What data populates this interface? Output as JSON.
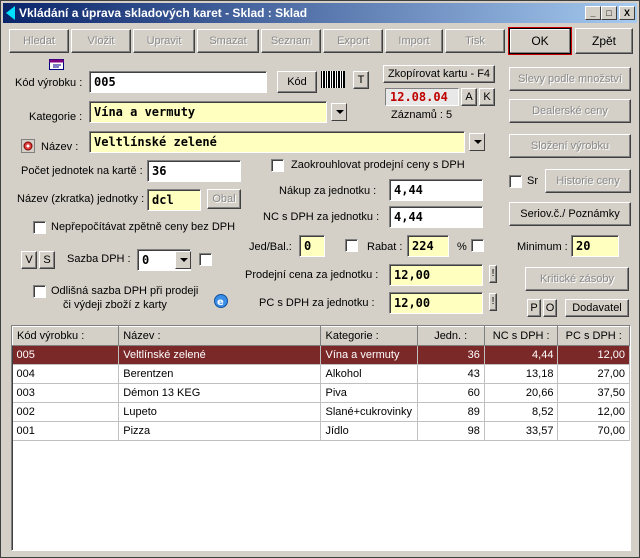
{
  "window": {
    "title": "Vkládání a úprava skladových karet  -  Sklad : Sklad",
    "min_label": "_",
    "max_label": "□",
    "close_label": "X"
  },
  "toolbar": {
    "buttons": [
      "Hledat",
      "Vložit",
      "Upravit",
      "Smazat",
      "Seznam",
      "Export",
      "Import",
      "Tisk"
    ],
    "ok_label": "OK",
    "back_label": "Zpět"
  },
  "form": {
    "code_label": "Kód výrobku :",
    "code_value": "005",
    "code_button": "Kód",
    "t_button": "T",
    "copy_button": "Zkopírovat kartu - F4",
    "date_value": "12.08.04",
    "a_button": "A",
    "k_button": "K",
    "records_label": "Záznamů : 5",
    "category_label": "Kategorie :",
    "category_value": "Vína a vermuty",
    "name_label": "Název :",
    "name_value": "Veltlínské zelené",
    "units_per_card_label": "Počet jednotek na kartě :",
    "units_per_card_value": "36",
    "unit_name_label": "Název (zkratka) jednotky :",
    "unit_name_value": "dcl",
    "obal_button": "Obal",
    "round_price_label": "Zaokrouhlovat prodejní ceny s DPH",
    "no_recalc_label": "Nepřepočítávat zpětně ceny bez DPH",
    "purchase_label": "Nákup za jednotku :",
    "purchase_value": "4,44",
    "nc_label": "NC s DPH za jednotku :",
    "nc_value": "4,44",
    "v_button": "V",
    "s_button": "S",
    "vat_rate_label": "Sazba DPH :",
    "vat_rate_value": "0",
    "jed_bal_label": "Jed/Bal.:",
    "jed_bal_value": "0",
    "rabat_label": "Rabat :",
    "rabat_value": "224",
    "percent_label": "%",
    "minimum_label": "Minimum :",
    "minimum_value": "20",
    "sale_price_label": "Prodejní cena za jednotku :",
    "sale_price_value": "12,00",
    "pc_label": "PC s DPH za jednotku :",
    "pc_value": "12,00",
    "excl_button": "!",
    "different_vat_label_1": "Odlišná sazba DPH při prodeji",
    "different_vat_label_2": "či výdeji zboží z karty",
    "sr_label": "Sr"
  },
  "side_buttons": {
    "discounts": "Slevy podle množství",
    "dealer": "Dealerské ceny",
    "composition": "Složení výrobku",
    "price_history": "Historie ceny",
    "serial": "Seriov.č./ Poznámky",
    "critical": "Kritické zásoby",
    "p_button": "P",
    "o_button": "O",
    "supplier": "Dodavatel"
  },
  "table": {
    "headers": [
      "Kód výrobku :",
      "Název :",
      "Kategorie :",
      "Jedn. :",
      "NC s DPH :",
      "PC s DPH :"
    ],
    "rows": [
      [
        "005",
        "Veltlínské zelené",
        "Vína a vermuty",
        "36",
        "4,44",
        "12,00"
      ],
      [
        "004",
        "Berentzen",
        "Alkohol",
        "43",
        "13,18",
        "27,00"
      ],
      [
        "003",
        "Démon 13 KEG",
        "Piva",
        "60",
        "20,66",
        "37,50"
      ],
      [
        "002",
        "Lupeto",
        "Slané+cukrovinky",
        "89",
        "8,52",
        "12,00"
      ],
      [
        "001",
        "Pizza",
        "Jídlo",
        "98",
        "33,57",
        "70,00"
      ]
    ]
  },
  "colors": {
    "selected_row": "#7b2828",
    "date_text": "#c00000",
    "yellow_field": "#ffffc0",
    "title_start": "#0a246a"
  }
}
